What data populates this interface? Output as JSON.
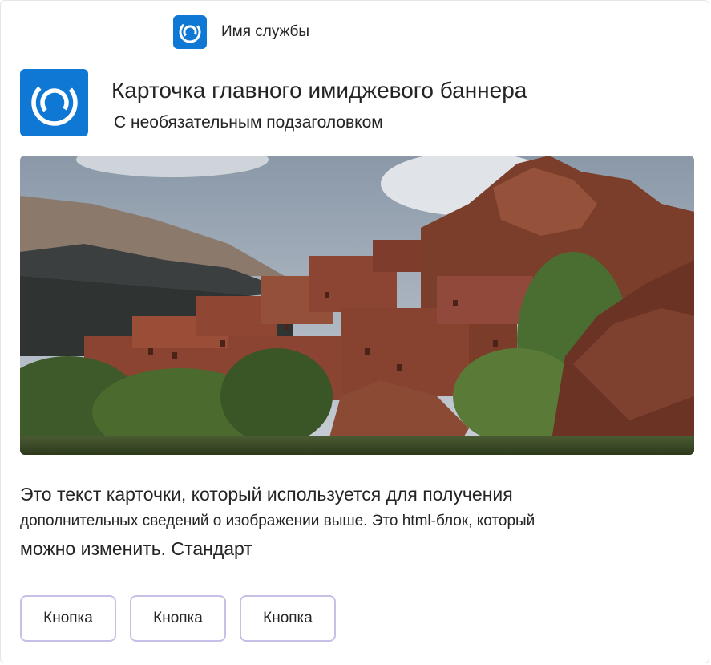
{
  "app": {
    "name": "Имя службы",
    "icon": "swirl-logo-icon",
    "accent_color": "#0f78d4"
  },
  "card": {
    "title": "Карточка главного имиджевого баннера",
    "subtitle": "С необязательным подзаголовком",
    "hero_image": "mountain-village-photo",
    "body": {
      "line1": "Это текст карточки, который используется для получения",
      "line2": "дополнительных сведений о изображении выше. Это html-блок, который",
      "line3": "можно изменить. Стандарт"
    },
    "buttons": [
      {
        "label": "Кнопка"
      },
      {
        "label": "Кнопка"
      },
      {
        "label": "Кнопка"
      }
    ],
    "button_border_color": "#c7c0e6"
  }
}
